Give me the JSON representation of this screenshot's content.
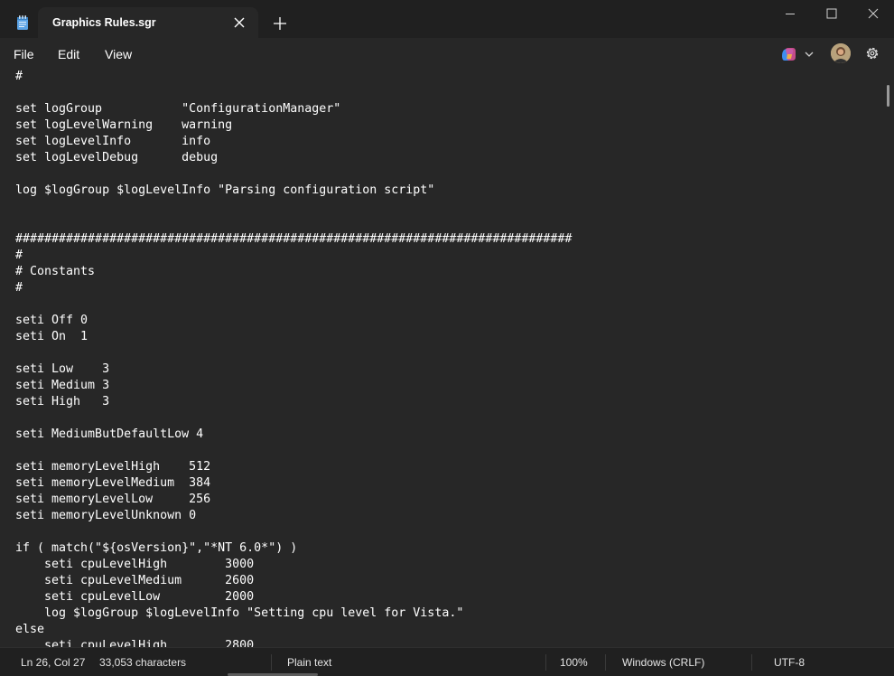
{
  "window": {
    "tab_title": "Graphics Rules.sgr"
  },
  "menu": {
    "file": "File",
    "edit": "Edit",
    "view": "View"
  },
  "editor": {
    "text": "#\n\nset logGroup           \"ConfigurationManager\"\nset logLevelWarning    warning\nset logLevelInfo       info\nset logLevelDebug      debug\n\nlog $logGroup $logLevelInfo \"Parsing configuration script\"\n\n\n#############################################################################\n#\n# Constants\n#\n\nseti Off 0\nseti On  1\n\nseti Low    3\nseti Medium 3\nseti High   3\n\nseti MediumButDefaultLow 4\n\nseti memoryLevelHigh    512\nseti memoryLevelMedium  384\nseti memoryLevelLow     256\nseti memoryLevelUnknown 0\n\nif ( match(\"${osVersion}\",\"*NT 6.0*\") )\n    seti cpuLevelHigh        3000\n    seti cpuLevelMedium      2600\n    seti cpuLevelLow         2000\n    log $logGroup $logLevelInfo \"Setting cpu level for Vista.\"\nelse\n    seti cpuLevelHigh        2800"
  },
  "status": {
    "position": "Ln 26, Col 27",
    "characters": "33,053 characters",
    "format": "Plain text",
    "zoom": "100%",
    "line_endings": "Windows (CRLF)",
    "encoding": "UTF-8"
  },
  "icons": {
    "app": "notepad-icon",
    "close_tab": "close-icon",
    "new_tab": "plus-icon",
    "minimize": "minimize-icon",
    "maximize": "maximize-icon",
    "close_window": "close-icon",
    "copilot": "copilot-icon",
    "settings": "gear-icon"
  },
  "colors": {
    "background": "#272727",
    "chrome": "#202020",
    "text": "#ffffff",
    "accent": "#5ba3e6"
  }
}
